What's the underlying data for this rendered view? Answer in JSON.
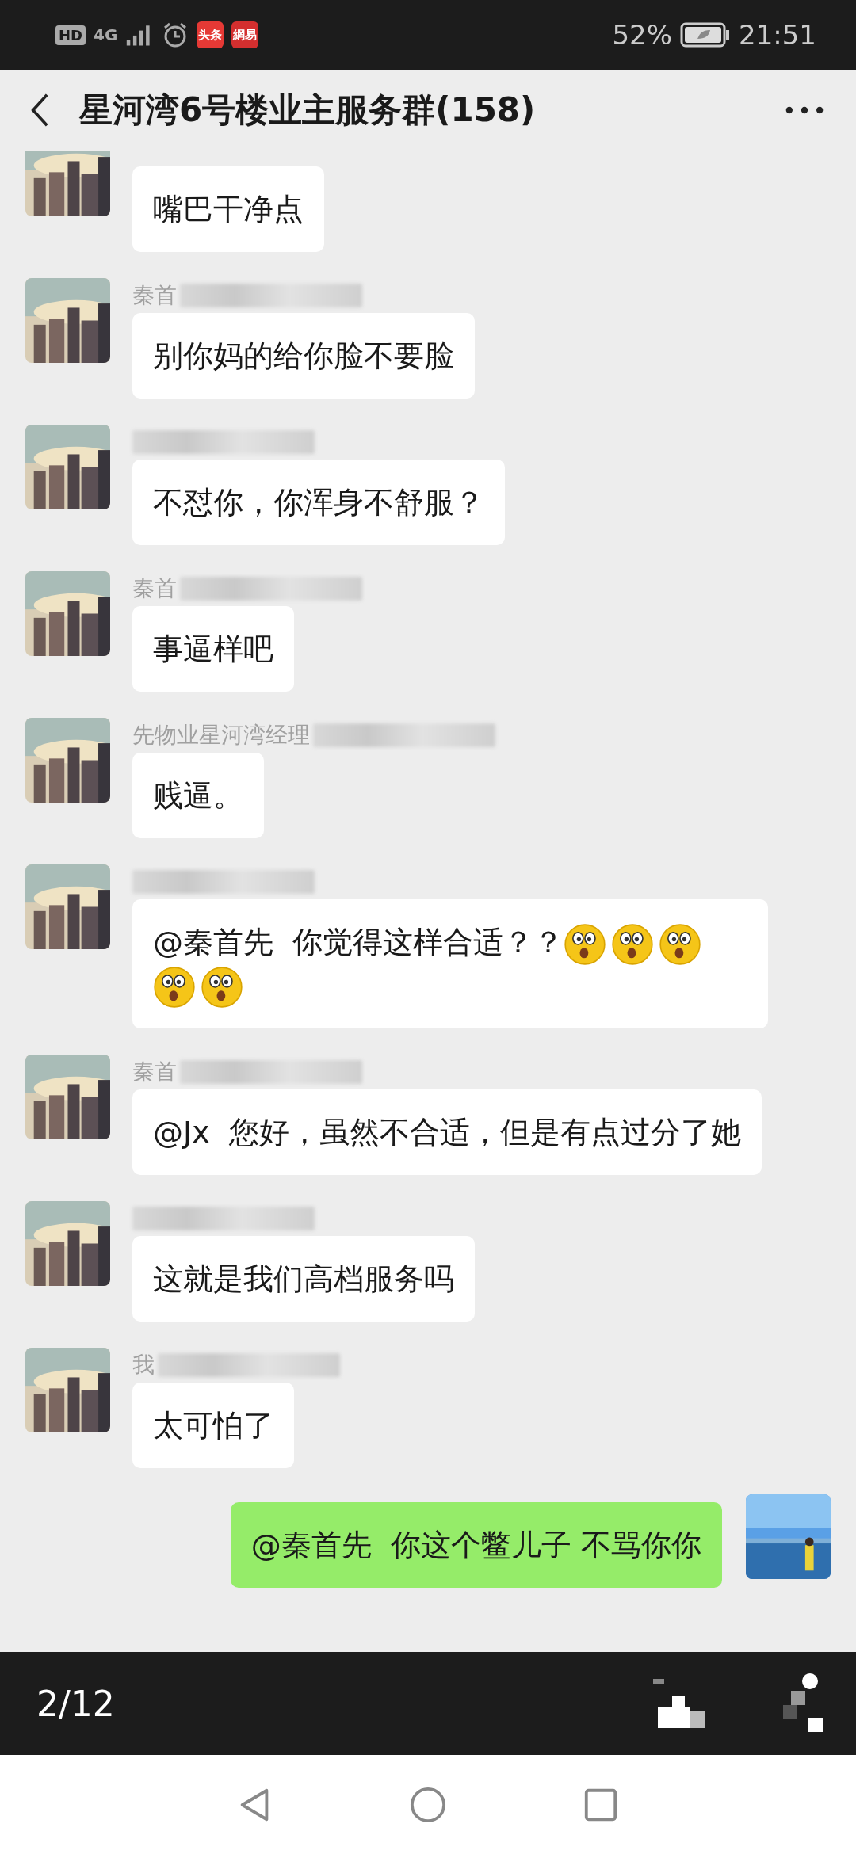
{
  "status_bar": {
    "indicators": [
      "HD",
      "4G"
    ],
    "app_icons": [
      {
        "label": "头条",
        "color": "#e53935"
      },
      {
        "label": "網易",
        "color": "#d32f2f"
      }
    ],
    "battery": "52%",
    "time": "21:51"
  },
  "header": {
    "title": "星河湾6号楼业主服务群(158)"
  },
  "messages": [
    {
      "kind": "incoming",
      "text": "嘴巴干净点"
    },
    {
      "kind": "incoming",
      "sender": "秦首",
      "name_blurred": true,
      "text": "别你妈的给你脸不要脸"
    },
    {
      "kind": "incoming",
      "name_blurred": true,
      "text": "不怼你，你浑身不舒服？"
    },
    {
      "kind": "incoming",
      "sender": "秦首",
      "name_blurred": true,
      "text": "事逼样吧"
    },
    {
      "kind": "incoming",
      "sender": "先物业星河湾经理",
      "name_blurred": true,
      "text": "贱逼。"
    },
    {
      "kind": "incoming",
      "name_blurred": true,
      "text": "@秦首先  你觉得这样合适？？",
      "emojis": [
        {
          "kind": "surprised"
        },
        {
          "kind": "surprised"
        },
        {
          "kind": "surprised"
        },
        {
          "kind": "surprised"
        },
        {
          "kind": "surprised"
        }
      ]
    },
    {
      "kind": "incoming",
      "sender": "秦首",
      "name_blurred": true,
      "text": "@Jx  您好，虽然不合适，但是有点过分了她"
    },
    {
      "kind": "incoming",
      "name_blurred": true,
      "text": "这就是我们高档服务吗"
    },
    {
      "kind": "incoming",
      "sender": "我",
      "name_blurred": true,
      "text": "太可怕了"
    },
    {
      "kind": "outgoing",
      "text": "@秦首先  你这个鳖儿子 不骂你你"
    }
  ],
  "viewer_bar": {
    "page": "2/12"
  }
}
